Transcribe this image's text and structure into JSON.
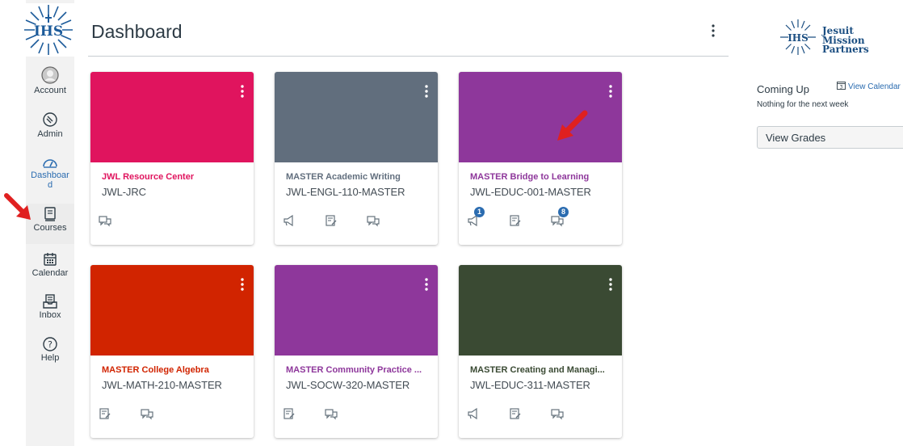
{
  "page": {
    "title": "Dashboard"
  },
  "nav": {
    "account": "Account",
    "admin": "Admin",
    "dashboard_line1": "Dashboar",
    "dashboard_line2": "d",
    "courses": "Courses",
    "calendar": "Calendar",
    "inbox": "Inbox",
    "help": "Help"
  },
  "cards": [
    {
      "name": "JWL Resource Center",
      "code": "JWL-JRC",
      "color": "#e0145e",
      "icons": [
        "discussion"
      ]
    },
    {
      "name": "MASTER Academic Writing",
      "code": "JWL-ENGL-110-MASTER",
      "color": "#616e7d",
      "icons": [
        "announcement",
        "assignment",
        "discussion"
      ]
    },
    {
      "name": "MASTER Bridge to Learning",
      "code": "JWL-EDUC-001-MASTER",
      "color": "#8e379b",
      "icons": [
        "announcement",
        "assignment",
        "discussion"
      ],
      "badges": {
        "announcement": "1",
        "discussion": "8"
      }
    },
    {
      "name": "MASTER College Algebra",
      "code": "JWL-MATH-210-MASTER",
      "color": "#d12400",
      "icons": [
        "assignment",
        "discussion"
      ]
    },
    {
      "name": "MASTER Community Practice ...",
      "code": "JWL-SOCW-320-MASTER",
      "color": "#8e379b",
      "icons": [
        "assignment",
        "discussion"
      ]
    },
    {
      "name": "MASTER Creating and Managi...",
      "code": "JWL-EDUC-311-MASTER",
      "color": "#3a4a33",
      "icons": [
        "announcement",
        "assignment",
        "discussion"
      ]
    }
  ],
  "sidebar": {
    "logo_text": [
      "Jesuit",
      "Mission",
      "Partners"
    ],
    "coming_up": "Coming Up",
    "view_calendar": "View Calendar",
    "nothing": "Nothing for the next week",
    "view_grades": "View Grades"
  },
  "colors": {
    "accent": "#2b6cb0",
    "annotation_arrow": "#e02020"
  }
}
